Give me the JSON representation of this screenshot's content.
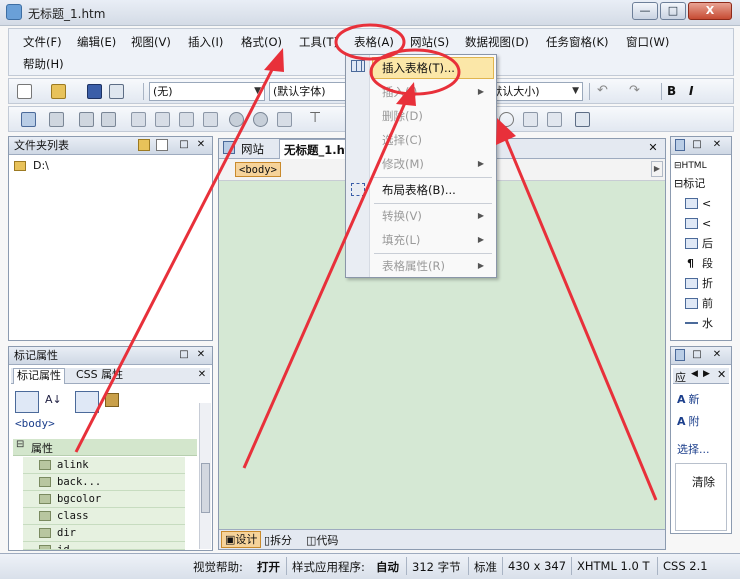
{
  "window": {
    "title": "无标题_1.htm",
    "min": "—",
    "max": "□",
    "close": "X"
  },
  "menubar": {
    "items": [
      "文件(F)",
      "编辑(E)",
      "视图(V)",
      "插入(I)",
      "格式(O)",
      "工具(T)",
      "表格(A)",
      "网站(S)",
      "数据视图(D)",
      "任务窗格(K)",
      "窗口(W)",
      "帮助(H)"
    ]
  },
  "toolbar1": {
    "style_combo": "(无)",
    "font_combo": "(默认字体)",
    "size_combo": "(默认大小)"
  },
  "table_menu": {
    "items": [
      {
        "label": "插入表格(T)...",
        "enabled": true,
        "submenu": false
      },
      {
        "label": "插入(I)",
        "enabled": false,
        "submenu": true
      },
      {
        "label": "删除(D)",
        "enabled": false,
        "submenu": false
      },
      {
        "label": "选择(C)",
        "enabled": false,
        "submenu": false
      },
      {
        "label": "修改(M)",
        "enabled": false,
        "submenu": true
      },
      {
        "label": "布局表格(B)...",
        "enabled": true,
        "submenu": false
      },
      {
        "label": "转换(V)",
        "enabled": false,
        "submenu": true
      },
      {
        "label": "填充(L)",
        "enabled": false,
        "submenu": true
      },
      {
        "label": "表格属性(R)",
        "enabled": false,
        "submenu": true
      }
    ]
  },
  "folder_panel": {
    "title": "文件夹列表",
    "drive": "D:\\"
  },
  "tag_panel": {
    "title": "标记属性",
    "tabs": [
      "标记属性",
      "CSS 属性"
    ],
    "tag": "<body>",
    "section": "属性",
    "attributes": [
      "alink",
      "back...",
      "bgcolor",
      "class",
      "dir",
      "id"
    ]
  },
  "document": {
    "tabs": [
      "网站",
      "无标题_1.htm"
    ],
    "breadcrumb": "<body>",
    "views": [
      "设计",
      "拆分",
      "代码"
    ]
  },
  "right_top_panel": {
    "rows": [
      "HTML",
      "标记",
      "<",
      "<",
      "后",
      "段",
      "折",
      "前",
      "水"
    ]
  },
  "right_bottom_panel": {
    "tab": "应",
    "rows": [
      "新",
      "附",
      "选择...",
      "清除"
    ]
  },
  "statusbar": {
    "visual_help": "视觉帮助:",
    "visual_help_value": "打开",
    "style_app": "样式应用程序:",
    "style_app_value": "自动",
    "size": "312 字节",
    "mode": "标准",
    "dims": "430 x 347",
    "doctype": "XHTML 1.0 T",
    "css": "CSS 2.1"
  },
  "colors": {
    "annotation": "#e8303a",
    "highlight": "#fbe7a8",
    "design_bg": "#d5e8d4"
  }
}
